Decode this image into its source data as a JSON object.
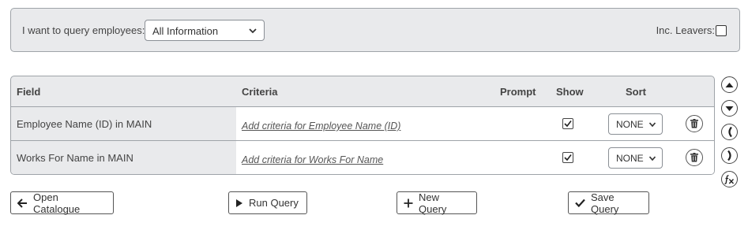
{
  "query_bar": {
    "label": "I want to query employees:",
    "selected_option": "All Information",
    "leavers_label": "Inc. Leavers:",
    "leavers_checked": false
  },
  "grid": {
    "columns": {
      "field": "Field",
      "criteria": "Criteria",
      "prompt": "Prompt",
      "show": "Show",
      "sort": "Sort"
    },
    "rows": [
      {
        "field": "Employee Name (ID) in MAIN",
        "criteria_link": "Add criteria for Employee Name (ID)",
        "show": true,
        "sort": "NONE"
      },
      {
        "field": "Works For Name in MAIN",
        "criteria_link": "Add criteria for Works For Name",
        "show": true,
        "sort": "NONE"
      }
    ]
  },
  "side_buttons": [
    "move-up-icon",
    "move-down-icon",
    "open-bracket-icon",
    "close-bracket-icon",
    "function-icon"
  ],
  "buttons": {
    "open_catalogue": "Open Catalogue",
    "run_query": "Run Query",
    "new_query": "New Query",
    "save_query": "Save Query"
  }
}
